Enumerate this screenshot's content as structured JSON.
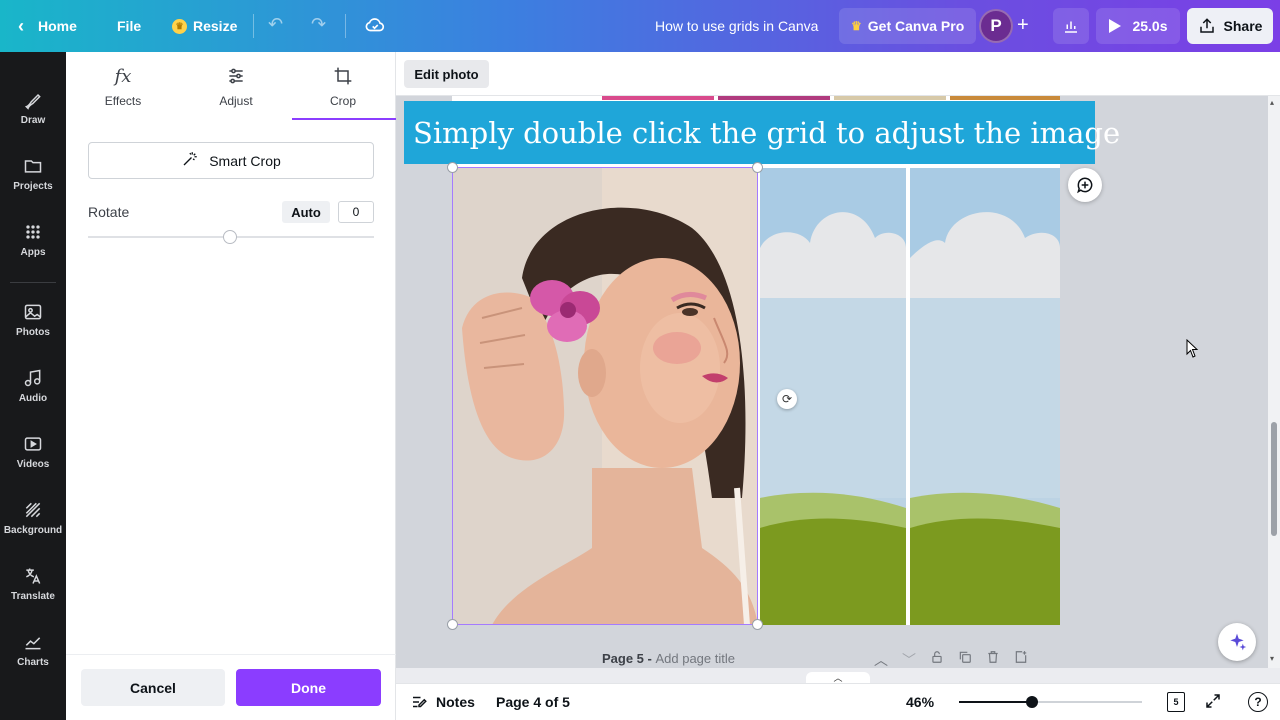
{
  "topbar": {
    "home_label": "Home",
    "file_label": "File",
    "resize_label": "Resize",
    "doc_title": "How to use grids in Canva",
    "pro_label": "Get Canva Pro",
    "avatar_initial": "P",
    "play_label": "25.0s",
    "share_label": "Share"
  },
  "rail": {
    "items": [
      {
        "label": "Draw",
        "icon": "draw-icon"
      },
      {
        "label": "Projects",
        "icon": "folder-icon"
      },
      {
        "label": "Apps",
        "icon": "apps-icon"
      },
      {
        "label": "Photos",
        "icon": "photo-icon"
      },
      {
        "label": "Audio",
        "icon": "audio-icon"
      },
      {
        "label": "Videos",
        "icon": "video-icon"
      },
      {
        "label": "Background",
        "icon": "background-icon"
      },
      {
        "label": "Translate",
        "icon": "translate-icon"
      },
      {
        "label": "Charts",
        "icon": "charts-icon"
      }
    ]
  },
  "panel": {
    "tabs": [
      {
        "label": "Effects",
        "icon": "fx"
      },
      {
        "label": "Adjust",
        "icon": "sliders"
      },
      {
        "label": "Crop",
        "icon": "crop"
      }
    ],
    "active_tab": "Crop",
    "smart_crop_label": "Smart Crop",
    "rotate_label": "Rotate",
    "auto_label": "Auto",
    "rotate_value": "0",
    "cancel_label": "Cancel",
    "done_label": "Done"
  },
  "context_bar": {
    "edit_photo_label": "Edit photo"
  },
  "canvas": {
    "caption": "Simply double click the grid to adjust the image",
    "page_label": "Page 5 - ",
    "page_title_placeholder": "Add page title"
  },
  "bottombar": {
    "notes_label": "Notes",
    "pages_label": "Page 4 of 5",
    "zoom_label": "46%",
    "zoom_level_percent": 46,
    "page_count": "5",
    "help_label": "?"
  },
  "colors": {
    "accent": "#8b3dff",
    "caption_bg": "#1fa6d9",
    "rail_bg": "#18191b"
  }
}
